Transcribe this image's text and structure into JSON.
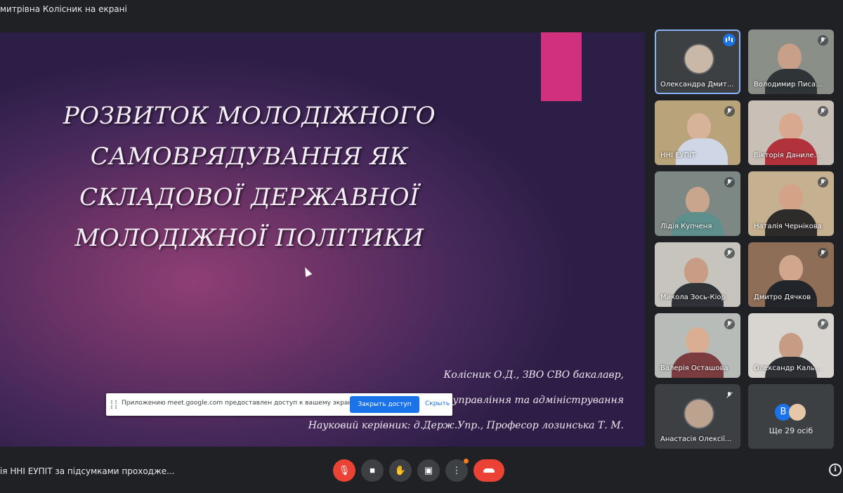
{
  "topbar": {
    "presenter_label": "митрівна Колісник на екрані"
  },
  "slide": {
    "title_lines": [
      "РОЗВИТОК МОЛОДІЖНОГО",
      "САМОВРЯДУВАННЯ ЯК",
      "СКЛАДОВОЇ ДЕРЖАВНОЇ",
      "МОЛОДІЖНОЇ ПОЛІТИКИ"
    ],
    "credit_lines": [
      "Колісник О.Д., ЗВО СВО бакалавр,",
      "Спеціальність 281 «Публічне управління та адміністрування",
      "Науковий керівник: д.Держ.Упр., Професор лозинська Т. М."
    ]
  },
  "share_bar": {
    "message": "Приложению meet.google.com предоставлен доступ к вашему экрану.",
    "stop_label": "Закрыть доступ",
    "hide_label": "Скрыть"
  },
  "participants": [
    {
      "name": "Олександра Дмит...",
      "status": "speaking"
    },
    {
      "name": "Володимир Писа...",
      "status": "muted"
    },
    {
      "name": "ННІ ЕУПІТ",
      "status": "muted"
    },
    {
      "name": "Вікторія Даниле...",
      "status": "muted"
    },
    {
      "name": "Лідія Купченя",
      "status": "muted"
    },
    {
      "name": "Наталія Чернікова",
      "status": "muted"
    },
    {
      "name": "Микола Зось-Кіор",
      "status": "muted"
    },
    {
      "name": "Дмитро Дячков",
      "status": "muted"
    },
    {
      "name": "Валерія Осташова",
      "status": "muted"
    },
    {
      "name": "Олександр Каль...",
      "status": "muted"
    },
    {
      "name": "Анастасія Олексії...",
      "status": "muted"
    }
  ],
  "more_tile": {
    "initial": "В",
    "label": "Ще 29 осіб"
  },
  "bottombar": {
    "meeting_title": "ія ННІ ЕУПІТ за підсумками проходже...",
    "controls": [
      {
        "icon": "mic-off-icon",
        "glyph": "🎙"
      },
      {
        "icon": "camera-icon",
        "glyph": "■"
      },
      {
        "icon": "raise-hand-icon",
        "glyph": "✋"
      },
      {
        "icon": "present-screen-icon",
        "glyph": "▣"
      },
      {
        "icon": "more-options-icon",
        "glyph": "⋮"
      }
    ],
    "info_glyph": "i"
  },
  "colors": {
    "accent": "#1a73e8",
    "danger": "#ea4335",
    "slide_pink": "#d1307e",
    "background": "#202124"
  }
}
